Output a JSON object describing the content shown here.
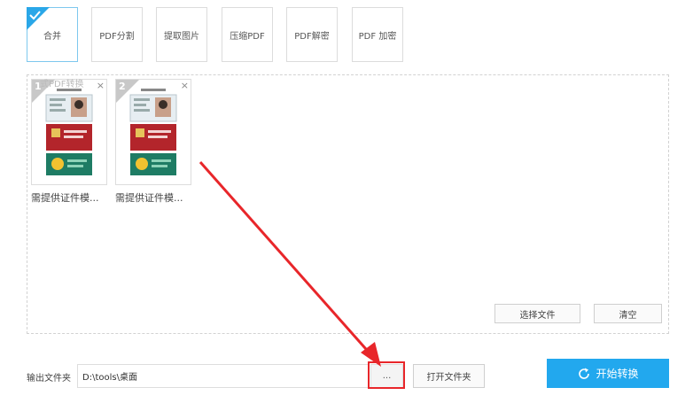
{
  "toolbar": {
    "tools": [
      {
        "label": "合并",
        "active": true
      },
      {
        "label": "PDF分割",
        "active": false
      },
      {
        "label": "提取图片",
        "active": false
      },
      {
        "label": "压缩PDF",
        "active": false
      },
      {
        "label": "PDF解密",
        "active": false
      },
      {
        "label": "PDF 加密",
        "active": false
      }
    ]
  },
  "files": {
    "ghost_text": "式PDF转换",
    "items": [
      {
        "index": "1",
        "caption": "需提供证件模...",
        "close": "×"
      },
      {
        "index": "2",
        "caption": "需提供证件模...",
        "close": "×"
      }
    ]
  },
  "actions": {
    "select_files": "选择文件",
    "clear": "清空"
  },
  "output": {
    "label": "输出文件夹",
    "path": "D:\\tools\\桌面",
    "browse": "...",
    "open_folder": "打开文件夹"
  },
  "start": {
    "label": "开始转换",
    "icon": "refresh-icon"
  },
  "colors": {
    "accent": "#22a8ee",
    "highlight": "#e8262a"
  }
}
